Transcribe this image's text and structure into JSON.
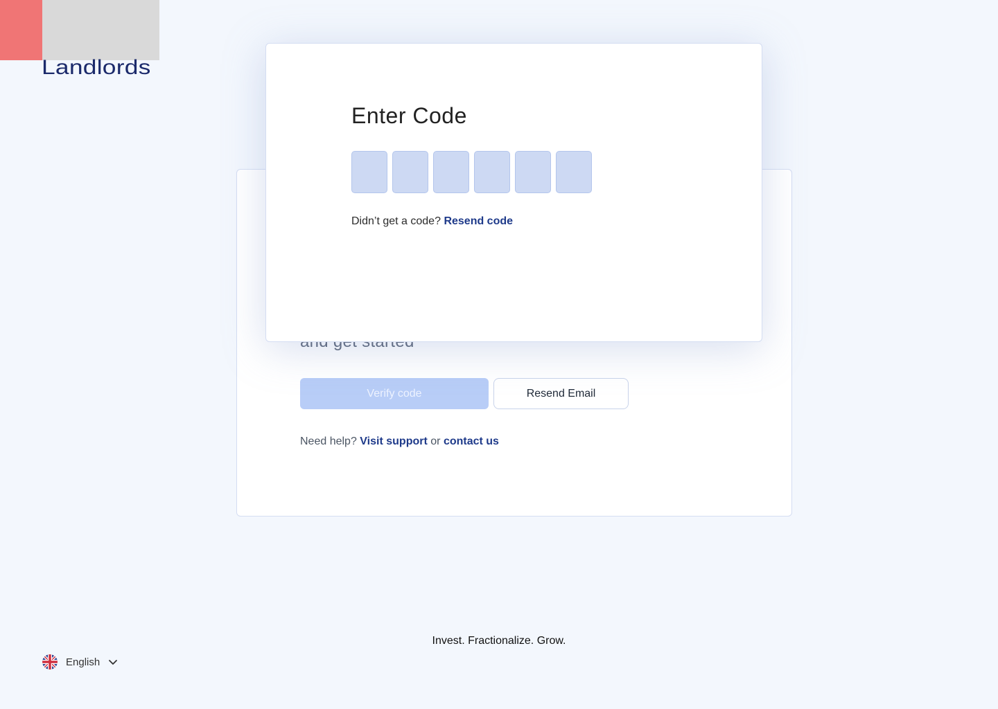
{
  "brand": {
    "logo_text": "Landlords",
    "colors": {
      "red": "#f07575",
      "navy": "#1b2a6b",
      "link": "#1e3a8a"
    }
  },
  "background_card": {
    "heading_partial": "and get started",
    "verify_button": "Verify code",
    "resend_email_button": "Resend Email",
    "help": {
      "prefix": "Need help?",
      "visit_support": "Visit support",
      "or": "or",
      "contact_us": "contact us"
    }
  },
  "modal": {
    "title": "Enter Code",
    "code_length": 6,
    "resend_prompt": "Didn’t get a code?",
    "resend_link": "Resend code"
  },
  "footer": {
    "tagline": "Invest. Fractionalize. Grow.",
    "language": {
      "label": "English",
      "icon": "uk-flag-icon"
    }
  }
}
